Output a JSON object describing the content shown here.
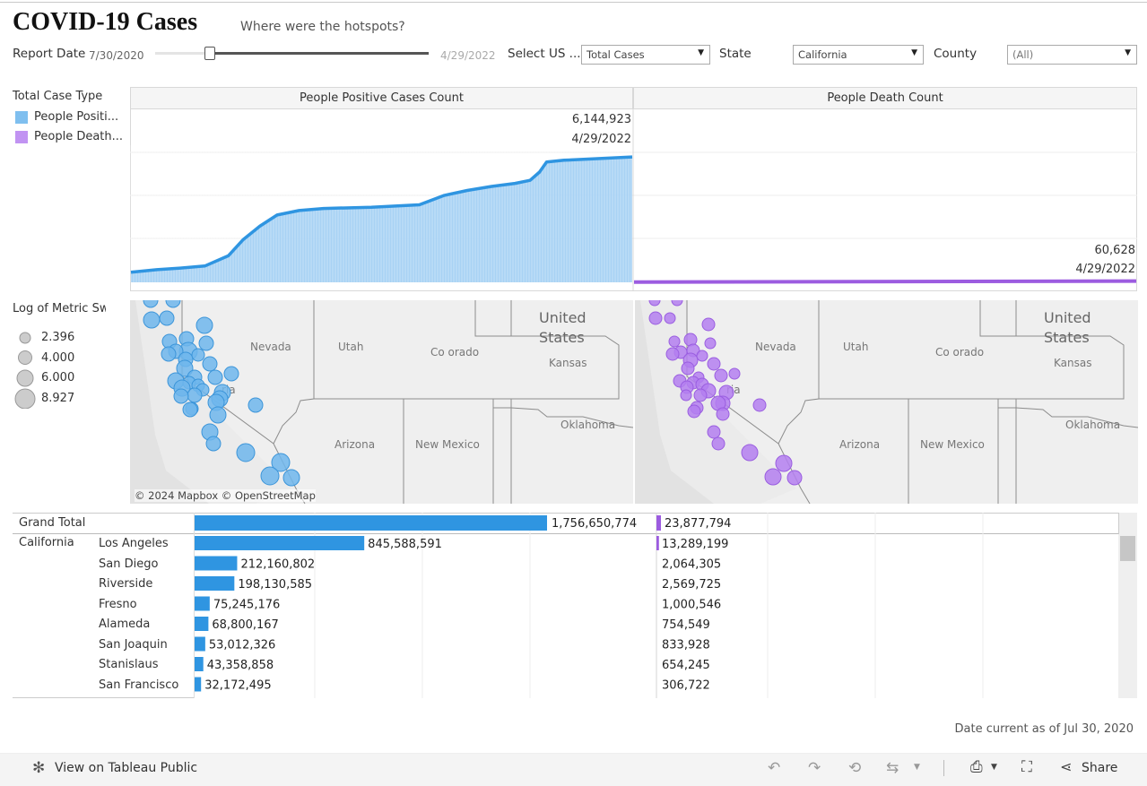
{
  "header": {
    "title": "COVID-19 Cases",
    "subtitle": "Where were the hotspots?"
  },
  "filters": {
    "report_date_label": "Report Date",
    "date_start": "7/30/2020",
    "date_end": "4/29/2022",
    "date_position_fraction": 0.2,
    "metric_label": "Select US ...",
    "metric_value": "Total Cases",
    "state_label": "State",
    "state_value": "California",
    "county_label": "County",
    "county_value": "(All)"
  },
  "legend": {
    "title": "Total Case Type",
    "items": [
      {
        "label": "People Positi...",
        "color": "#7fbfef"
      },
      {
        "label": "People Death...",
        "color": "#c193f2"
      }
    ]
  },
  "size_legend": {
    "title": "Log of Metric Sw",
    "items": [
      "2.396",
      "4.000",
      "6.000",
      "8.927"
    ]
  },
  "chart_data": [
    {
      "type": "area",
      "title": "People Positive Cases Count",
      "color": "#2f95e1",
      "ylim": [
        0,
        6500000
      ],
      "x": [
        "7/30/2020",
        "9/1/2020",
        "10/1/2020",
        "11/1/2020",
        "12/1/2020",
        "12/20/2020",
        "1/10/2021",
        "2/1/2021",
        "3/1/2021",
        "4/1/2021",
        "6/1/2021",
        "8/1/2021",
        "9/1/2021",
        "10/1/2021",
        "11/1/2021",
        "12/1/2021",
        "12/20/2021",
        "1/1/2022",
        "1/10/2022",
        "2/1/2022",
        "4/29/2022"
      ],
      "y": [
        490000,
        620000,
        700000,
        800000,
        1300000,
        2100000,
        2750000,
        3300000,
        3520000,
        3620000,
        3680000,
        3800000,
        4250000,
        4500000,
        4700000,
        4850000,
        5000000,
        5400000,
        5900000,
        5980000,
        6144923
      ],
      "last_value_label": "6,144,923",
      "last_date_label": "4/29/2022"
    },
    {
      "type": "area",
      "title": "People Death Count",
      "color": "#9c5ce0",
      "ylim": [
        0,
        6500000
      ],
      "x": [
        "7/30/2020",
        "4/29/2022"
      ],
      "y": [
        8000,
        60628
      ],
      "last_value_label": "60,628",
      "last_date_label": "4/29/2022"
    }
  ],
  "maps": {
    "attribution": "© 2024 Mapbox  © OpenStreetMap",
    "labels": {
      "nevada": "Nevada",
      "utah": "Utah",
      "colorado": "Co orado",
      "united": "United",
      "states": "States",
      "kansas": "Kansas",
      "oklahoma": "Oklahoma",
      "arizona": "Arizona",
      "newmexico": "New Mexico",
      "california": "ria"
    },
    "positive_color": "#6fb6ec",
    "death_color": "#b47ff0"
  },
  "table": {
    "grand_total": {
      "label": "Grand Total",
      "positive": "1,756,650,774",
      "death": "23,877,794"
    },
    "state": "California",
    "rows": [
      {
        "county": "Los Angeles",
        "positive": "845,588,591",
        "death": "13,289,199"
      },
      {
        "county": "San Diego",
        "positive": "212,160,802",
        "death": "2,064,305"
      },
      {
        "county": "Riverside",
        "positive": "198,130,585",
        "death": "2,569,725"
      },
      {
        "county": "Fresno",
        "positive": "75,245,176",
        "death": "1,000,546"
      },
      {
        "county": "Alameda",
        "positive": "68,800,167",
        "death": "754,549"
      },
      {
        "county": "San Joaquin",
        "positive": "53,012,326",
        "death": "833,928"
      },
      {
        "county": "Stanislaus",
        "positive": "43,358,858",
        "death": "654,245"
      },
      {
        "county": "San Francisco",
        "positive": "32,172,495",
        "death": "306,722"
      }
    ],
    "positive_values": [
      845588591,
      212160802,
      198130585,
      75245176,
      68800167,
      53012326,
      43358858,
      32172495
    ],
    "death_values": [
      13289199,
      2064305,
      2569725,
      1000546,
      754549,
      833928,
      654245,
      306722
    ],
    "positive_total_value": 1756650774,
    "death_total_value": 23877794
  },
  "date_current": "Date current as of Jul 30, 2020",
  "footer": {
    "view_label": "View on Tableau Public",
    "share_label": "Share"
  }
}
